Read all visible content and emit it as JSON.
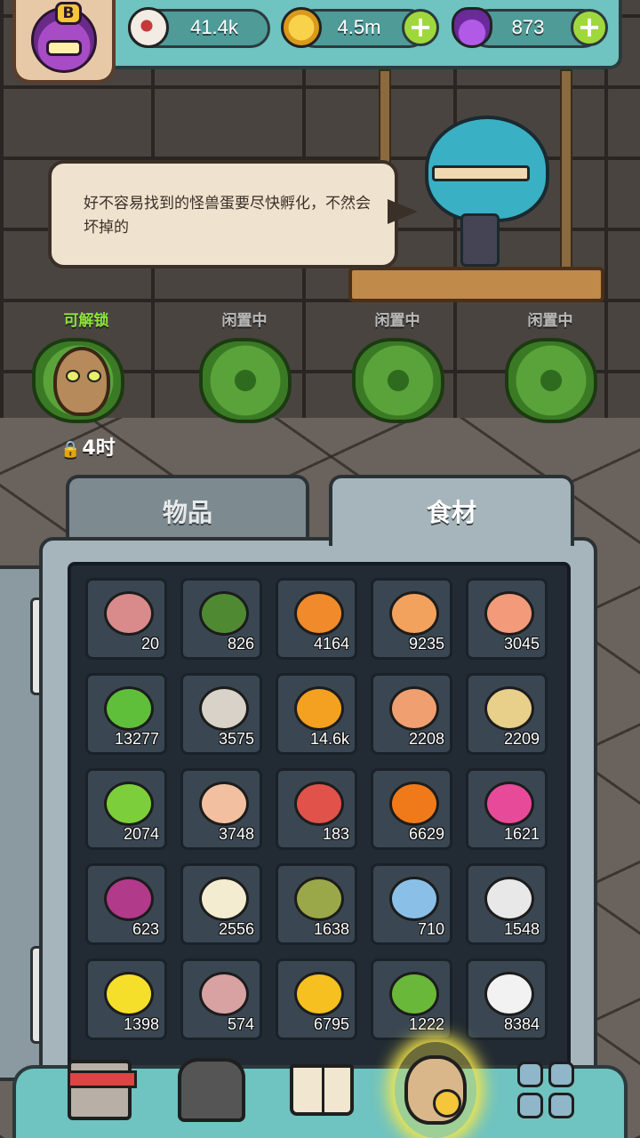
{
  "header": {
    "rank_letter": "B",
    "resources": [
      {
        "icon": "eyeball-icon",
        "value": "41.4k"
      },
      {
        "icon": "gold-coin-icon",
        "value": "4.5m",
        "add": "+"
      },
      {
        "icon": "purple-potion-icon",
        "value": "873",
        "add": "+"
      }
    ]
  },
  "dialog": {
    "text": "好不容易找到的怪兽蛋要尽快孵化，不然会坏掉的"
  },
  "incubators": [
    {
      "status": "可解锁",
      "state": "ready",
      "timer": "4时"
    },
    {
      "status": "闲置中",
      "state": "idle"
    },
    {
      "status": "闲置中",
      "state": "idle"
    },
    {
      "status": "闲置中",
      "state": "idle"
    }
  ],
  "tabs": [
    {
      "label": "物品",
      "active": false
    },
    {
      "label": "食材",
      "active": true
    }
  ],
  "inventory": [
    {
      "name": "meatballs-icon",
      "qty": "20",
      "color": "#d98a8a"
    },
    {
      "name": "seaweed-icon",
      "qty": "826",
      "color": "#4f8a32"
    },
    {
      "name": "carrot-icon",
      "qty": "4164",
      "color": "#f08a2a"
    },
    {
      "name": "spotted-egg-icon",
      "qty": "9235",
      "color": "#f2a25c"
    },
    {
      "name": "salmon-steak-icon",
      "qty": "3045",
      "color": "#f29a7a"
    },
    {
      "name": "lettuce-icon",
      "qty": "13277",
      "color": "#5fbf3a"
    },
    {
      "name": "oyster-icon",
      "qty": "3575",
      "color": "#d8d2c8"
    },
    {
      "name": "mushroom-icon",
      "qty": "14.6k",
      "color": "#f4a020"
    },
    {
      "name": "shrimp-icon",
      "qty": "2208",
      "color": "#f0a070"
    },
    {
      "name": "noodles-icon",
      "qty": "2209",
      "color": "#e8cf8a"
    },
    {
      "name": "peas-icon",
      "qty": "2074",
      "color": "#7ccf3a"
    },
    {
      "name": "drumstick-icon",
      "qty": "3748",
      "color": "#f2c0a0"
    },
    {
      "name": "ribs-icon",
      "qty": "183",
      "color": "#e0524a"
    },
    {
      "name": "pumpkin-icon",
      "qty": "6629",
      "color": "#f07a1a"
    },
    {
      "name": "dragon-fruit-icon",
      "qty": "1621",
      "color": "#e84a9a"
    },
    {
      "name": "red-onion-icon",
      "qty": "623",
      "color": "#b23a8a"
    },
    {
      "name": "banana-icon",
      "qty": "2556",
      "color": "#f3ecd0"
    },
    {
      "name": "root-vegetable-icon",
      "qty": "1638",
      "color": "#9aa84a"
    },
    {
      "name": "frozen-meat-icon",
      "qty": "710",
      "color": "#8ac0e8"
    },
    {
      "name": "bones-icon",
      "qty": "1548",
      "color": "#e8e8e8"
    },
    {
      "name": "lemon-icon",
      "qty": "1398",
      "color": "#f5df2a"
    },
    {
      "name": "sea-cucumber-icon",
      "qty": "574",
      "color": "#d8a2a2"
    },
    {
      "name": "corn-icon",
      "qty": "6795",
      "color": "#f5c020"
    },
    {
      "name": "bitter-melon-icon",
      "qty": "1222",
      "color": "#6ab83a"
    },
    {
      "name": "rice-icon",
      "qty": "8384",
      "color": "#f2f2f2"
    }
  ],
  "bottom_nav": [
    {
      "name": "shop-icon"
    },
    {
      "name": "arena-icon"
    },
    {
      "name": "recipe-book-icon"
    },
    {
      "name": "bag-icon",
      "active": true
    },
    {
      "name": "more-icon"
    }
  ]
}
